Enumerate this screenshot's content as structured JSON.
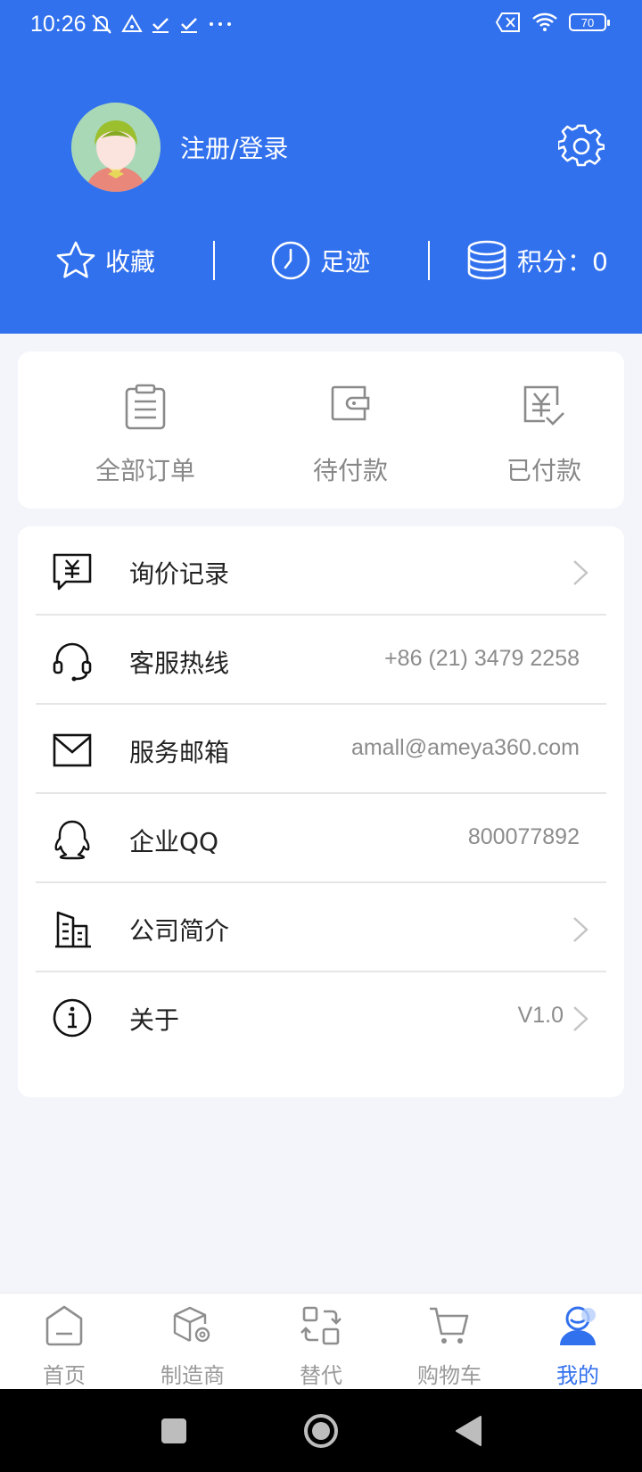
{
  "status_bar": {
    "time": "10:26",
    "battery": "70",
    "icons": [
      "mute-icon",
      "alert-icon",
      "check-icon",
      "check-icon",
      "more-icon",
      "sim-x-icon",
      "wifi-icon",
      "battery-icon"
    ]
  },
  "profile": {
    "login_label": "注册/登录"
  },
  "quick_links": {
    "favorites": "收藏",
    "history": "足迹",
    "points": "积分：0"
  },
  "orders": [
    {
      "label": "全部订单",
      "icon": "clipboard-icon"
    },
    {
      "label": "待付款",
      "icon": "wallet-icon"
    },
    {
      "label": "已付款",
      "icon": "paid-icon"
    }
  ],
  "menu": [
    {
      "title": "询价记录",
      "value": "",
      "arrow": true,
      "icon": "inquiry-icon"
    },
    {
      "title": "客服热线",
      "value": "+86 (21) 3479 2258",
      "arrow": false,
      "icon": "headset-icon"
    },
    {
      "title": "服务邮箱",
      "value": "amall@ameya360.com",
      "arrow": false,
      "icon": "mail-icon"
    },
    {
      "title": "企业QQ",
      "value": "800077892",
      "arrow": false,
      "icon": "qq-icon"
    },
    {
      "title": "公司简介",
      "value": "",
      "arrow": true,
      "icon": "building-icon"
    },
    {
      "title": "关于",
      "value": "V1.0",
      "arrow": true,
      "icon": "info-icon"
    }
  ],
  "tabs": [
    {
      "label": "首页",
      "icon": "home-icon",
      "active": false
    },
    {
      "label": "制造商",
      "icon": "manufacturer-icon",
      "active": false
    },
    {
      "label": "替代",
      "icon": "swap-icon",
      "active": false
    },
    {
      "label": "购物车",
      "icon": "cart-icon",
      "active": false
    },
    {
      "label": "我的",
      "icon": "profile-icon",
      "active": true
    }
  ],
  "colors": {
    "brand_blue": "#3271ee",
    "background": "#f4f5fa",
    "muted_text": "#8c8c8c"
  }
}
